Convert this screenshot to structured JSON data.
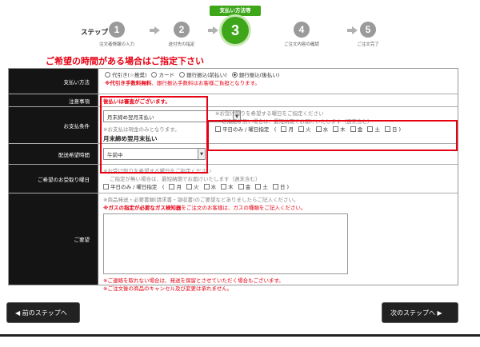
{
  "steps": {
    "label": "ステップ",
    "active_tag": "支払い方法等",
    "items": [
      {
        "num": "1",
        "caption": "注文者情報の入力"
      },
      {
        "num": "2",
        "caption": "送付先の指定"
      },
      {
        "num": "3",
        "caption": ""
      },
      {
        "num": "4",
        "caption": "ご注文内容の確認"
      },
      {
        "num": "5",
        "caption": "ご注文完了"
      }
    ]
  },
  "notice": "ご希望の時間がある場合はご指定下さい",
  "payment": {
    "label": "支払い方法",
    "options": [
      "代引き(☆推奨)",
      "カード",
      "銀行振込(前払い)",
      "銀行振込(後払い)"
    ],
    "note_bold": "※代引き手数料無料",
    "note_rest": "、銀行振込手数料はお客様ご負担となります。"
  },
  "caution": {
    "label": "注意事項",
    "text": "後払いは審査がございます。"
  },
  "terms": {
    "label": "お支払条件",
    "select_value": "月末締め翌月末払い",
    "note": "※お支払は現金のみとなります。",
    "result": "月末締め翌月末払い"
  },
  "inner_day": {
    "line1": "※お受け取りを希望する曜日をご指定ください",
    "line2": "ご指定が無い場合は、最短納期でお届けいたします（週末含む）",
    "weekday_only": "平日のみ / 曜日指定　(",
    "days": [
      "月",
      "火",
      "水",
      "木",
      "金",
      "土",
      "日"
    ],
    "close": ")"
  },
  "time": {
    "label": "配送希望時間",
    "select_value": "午前中"
  },
  "day": {
    "label": "ご希望のお受取り曜日",
    "line1": "※お受け取りを希望する曜日をご指定ください",
    "line2": "ご指定が無い場合は、最短納期でお届けいたします（週末含む）",
    "weekday_only": "平日のみ / 曜日指定　(",
    "days": [
      "月",
      "火",
      "水",
      "木",
      "金",
      "土",
      "日"
    ],
    "close": ")"
  },
  "request": {
    "label": "ご要望",
    "line1": "※商品発送・必要書類(請求書・領収書)のご要望などありましたらご記入ください。",
    "line2_bold": "※ガスの指定が必要なガス検知器",
    "line2_rest": "をご注文のお客様は、ガスの種類をご記入ください。",
    "foot1": "※ご連絡を取れない場合は、発送を保留とさせていただく場合もございます。",
    "foot2": "※ご注文後の商品のキャンセル及び変更は承れません。"
  },
  "nav": {
    "prev": "前のステップへ",
    "next": "次のステップへ"
  }
}
